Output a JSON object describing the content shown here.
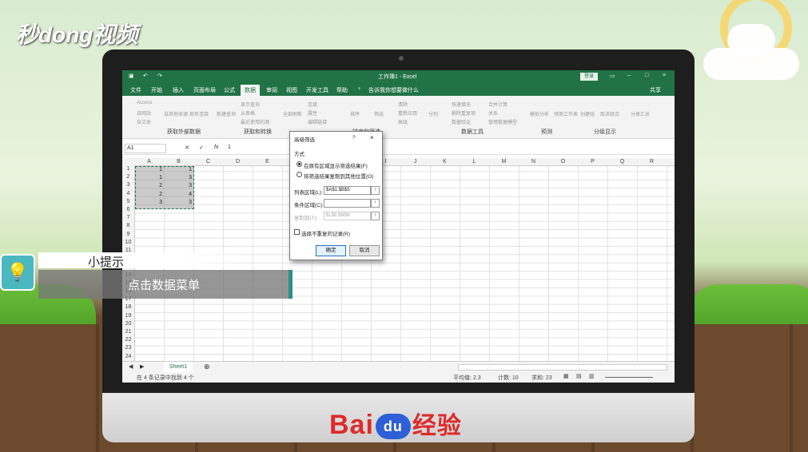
{
  "watermark": {
    "brand": "秒dong视频"
  },
  "bottom_brand": {
    "part1": "Bai",
    "part2": "du",
    "part3": "经验"
  },
  "excel": {
    "window_title": "工作簿1 - Excel",
    "login_button": "登录",
    "share_label": "共享",
    "tabs": [
      "文件",
      "开始",
      "插入",
      "页面布局",
      "公式",
      "数据",
      "审阅",
      "视图",
      "开发工具",
      "帮助"
    ],
    "active_tab": "数据",
    "tell_me": "告诉我你想要做什么",
    "ribbon_groups": [
      "获取外部数据",
      "获取和转换",
      "排序和筛选",
      "数据工具",
      "预测",
      "分级显示"
    ],
    "ribbon_items": [
      "Access",
      "自网站",
      "自文本",
      "自其他来源",
      "现有连接",
      "新建查询",
      "显示查询",
      "从表格",
      "最近使用的源",
      "全部刷新",
      "连接",
      "属性",
      "编辑链接",
      "排序",
      "筛选",
      "清除",
      "重新应用",
      "高级",
      "分列",
      "快速填充",
      "删除重复项",
      "数据验证",
      "合并计算",
      "关系",
      "管理数据模型",
      "模拟分析",
      "预测工作表",
      "创建组",
      "取消组合",
      "分类汇总"
    ],
    "name_box": "A1",
    "formula_value": "1",
    "columns": [
      "A",
      "B",
      "C",
      "D",
      "E",
      "F",
      "G",
      "H",
      "I",
      "J",
      "K",
      "L",
      "M",
      "N",
      "O",
      "P",
      "Q",
      "R"
    ],
    "rows": [
      "1",
      "2",
      "3",
      "4",
      "5",
      "6",
      "7",
      "8",
      "9",
      "10",
      "11",
      "12",
      "13",
      "14",
      "15",
      "16",
      "17",
      "18",
      "19",
      "20",
      "21",
      "22",
      "23",
      "24"
    ],
    "cells": {
      "A": [
        "1",
        "1",
        "2",
        "2",
        "3"
      ],
      "B": [
        "1",
        "3",
        "3",
        "4",
        "3"
      ]
    },
    "sheet_tab": "Sheet1",
    "status": {
      "left": "在 4 条记录中找到 4 个",
      "average": "平均值: 2.3",
      "count": "计数: 10",
      "sum": "求和: 23"
    }
  },
  "dialog": {
    "title": "高级筛选",
    "help": "?",
    "close": "×",
    "section": "方式",
    "option1": "在原有区域显示筛选结果(F)",
    "option2": "将筛选结果复制到其他位置(O)",
    "list_range_label": "列表区域(L):",
    "list_range_value": "$A$1:$B$5",
    "criteria_label": "条件区域(C):",
    "criteria_value": "",
    "copy_to_label": "复制到(T):",
    "copy_to_value": "$L$8:$M$8",
    "unique_label": "选择不重复的记录(R)",
    "ok": "确定",
    "cancel": "取消"
  },
  "tip": {
    "heading": "小提示",
    "body": "点击数据菜单"
  }
}
